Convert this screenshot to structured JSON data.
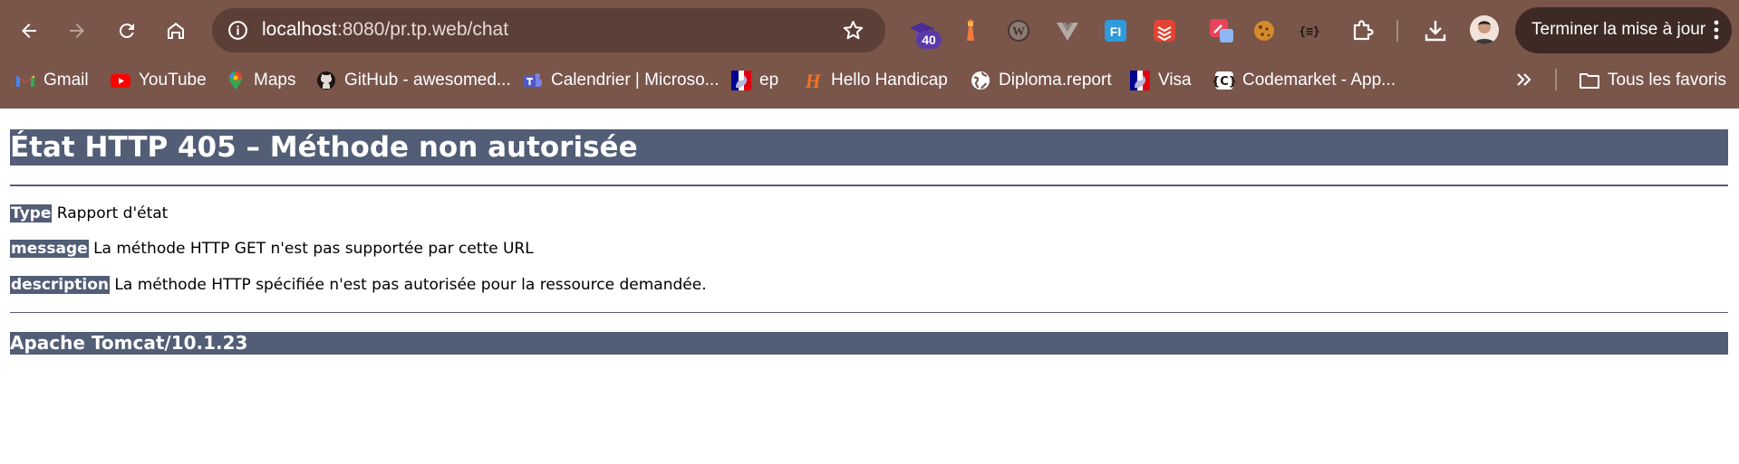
{
  "browser": {
    "address": {
      "host": "localhost",
      "path": ":8080/pr.tp.web/chat"
    },
    "extension_badge": "40",
    "update_button_label": "Terminer la mise à jour",
    "theme": {
      "frame": "#79554a",
      "omnibox": "#5c3f37"
    },
    "icons": {
      "back": "arrow-left",
      "forward": "arrow-right",
      "reload": "reload",
      "home": "home",
      "site_info": "site-info",
      "bookmark": "star",
      "extensions": "puzzle",
      "downloads": "download",
      "menu": "three-dots"
    }
  },
  "bookmarks": {
    "items": [
      {
        "label": "Gmail",
        "icon": "gmail"
      },
      {
        "label": "YouTube",
        "icon": "youtube"
      },
      {
        "label": "Maps",
        "icon": "maps"
      },
      {
        "label": "GitHub - awesomed...",
        "icon": "github"
      },
      {
        "label": "Calendrier | Microso...",
        "icon": "teams"
      },
      {
        "label": "ep",
        "icon": "marianne"
      },
      {
        "label": "Hello Handicap",
        "icon": "hello-handicap"
      },
      {
        "label": "Diploma.report",
        "icon": "globe"
      },
      {
        "label": "Visa",
        "icon": "marianne"
      },
      {
        "label": "Codemarket - App...",
        "icon": "codemarket"
      }
    ],
    "all_bookmarks_label": "Tous les favoris"
  },
  "page": {
    "title": "État HTTP 405 – Méthode non autorisée",
    "rows": [
      {
        "key": "Type",
        "value": "Rapport d'état"
      },
      {
        "key": "message",
        "value": "La méthode HTTP GET n'est pas supportée par cette URL"
      },
      {
        "key": "description",
        "value": "La méthode HTTP spécifiée n'est pas autorisée pour la ressource demandée."
      }
    ],
    "footer": "Apache Tomcat/10.1.23",
    "accent": "#525d76"
  }
}
